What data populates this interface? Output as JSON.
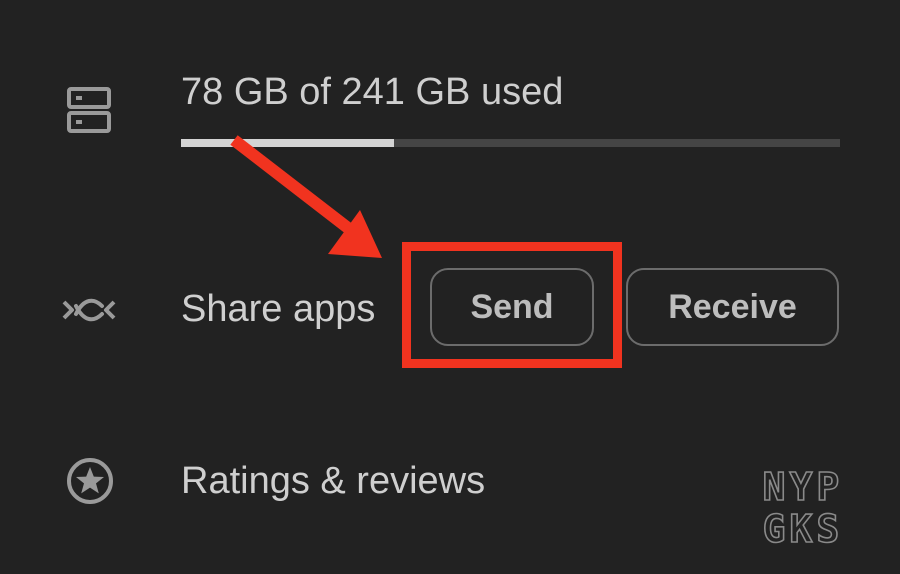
{
  "storage": {
    "icon": "storage-icon",
    "text": "78 GB of 241 GB used",
    "used_gb": 78,
    "total_gb": 241
  },
  "share_apps": {
    "icon": "share-apps-icon",
    "label": "Share apps",
    "send_label": "Send",
    "receive_label": "Receive"
  },
  "ratings": {
    "icon": "star-icon",
    "label": "Ratings & reviews"
  },
  "annotation": {
    "color": "#f1331f",
    "target": "send-button"
  },
  "watermark": {
    "line1": "NYP",
    "line2": "GKS"
  }
}
